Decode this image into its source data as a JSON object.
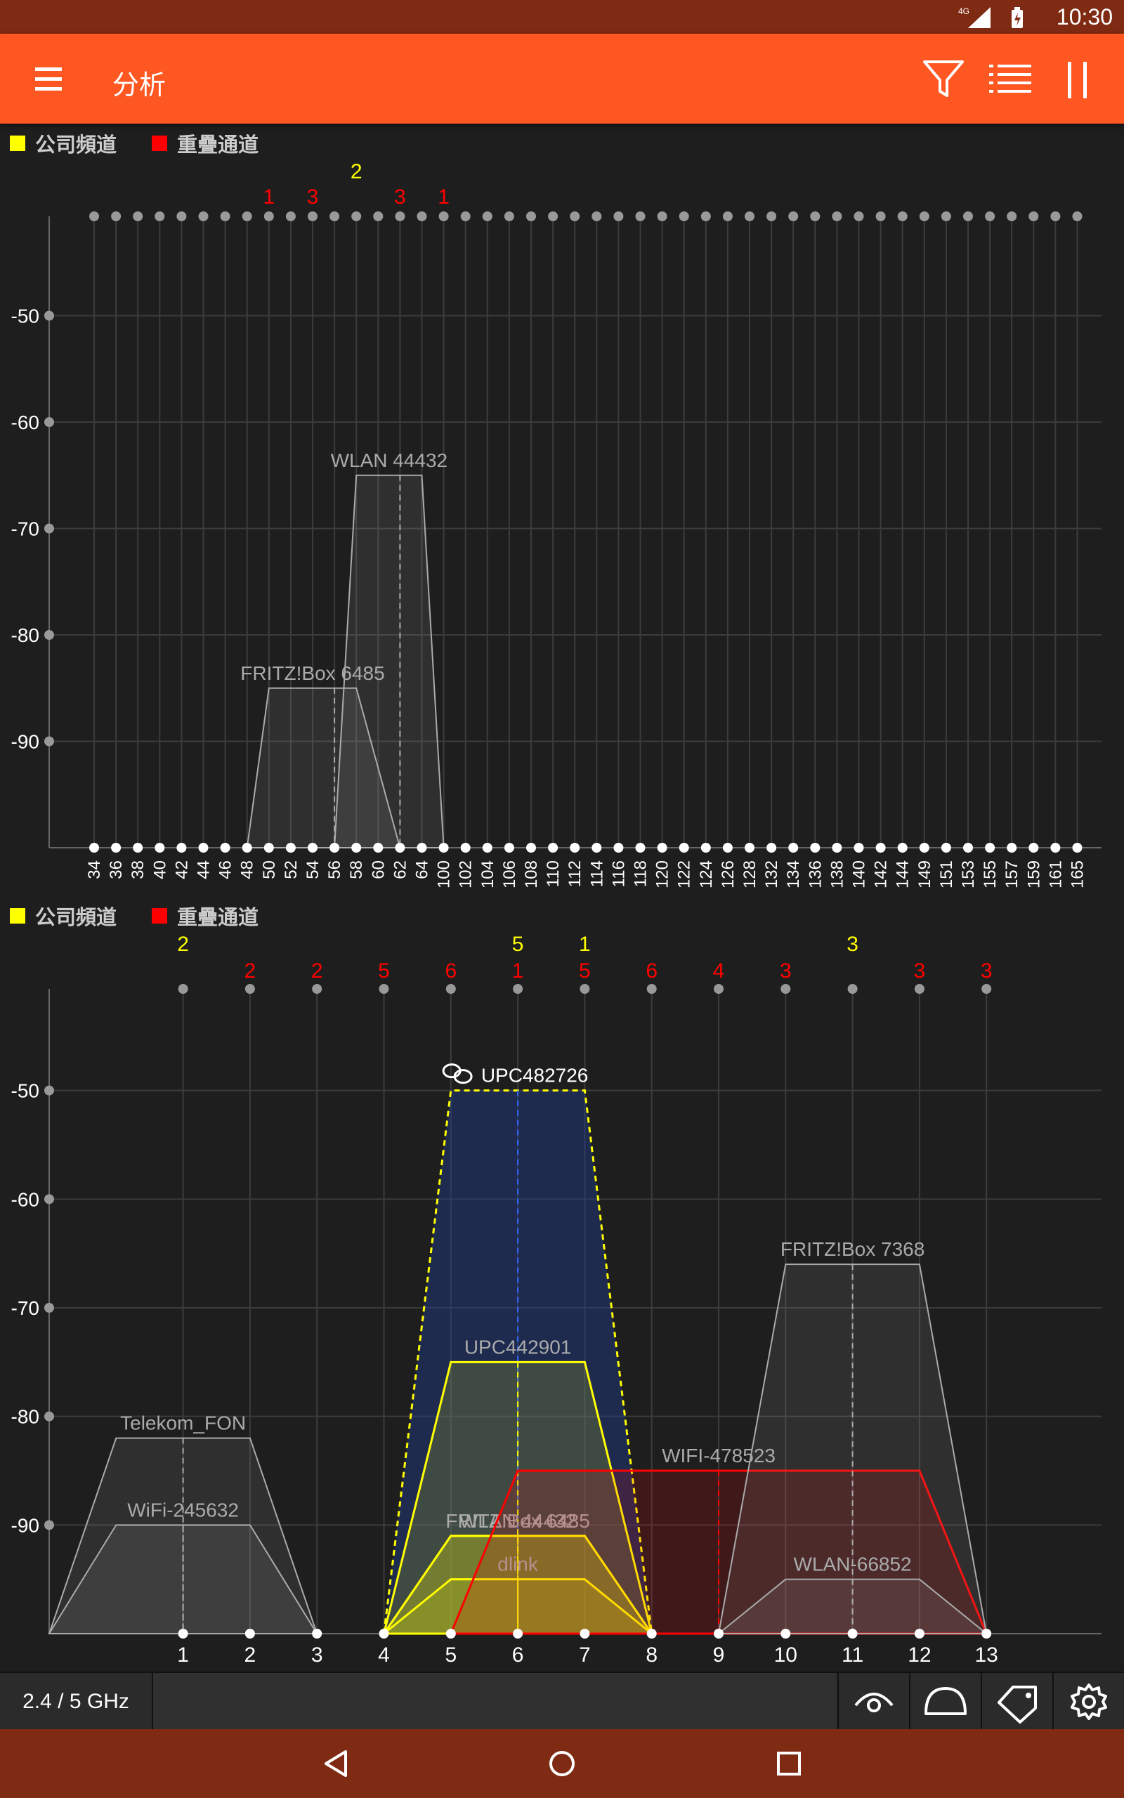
{
  "status": {
    "time": "10:30",
    "network": "4G"
  },
  "appbar": {
    "title": "分析"
  },
  "legend": {
    "company_label": "公司頻道",
    "overlap_label": "重疊通道",
    "company_color": "#ffff00",
    "overlap_color": "#ff0000"
  },
  "chart_data": [
    {
      "type": "area",
      "band": "5 GHz",
      "yticks": [
        "-50",
        "-60",
        "-70",
        "-80",
        "-90"
      ],
      "ylim": [
        -100,
        -40
      ],
      "x": [
        "34",
        "36",
        "38",
        "40",
        "42",
        "44",
        "46",
        "48",
        "50",
        "52",
        "54",
        "56",
        "58",
        "60",
        "62",
        "64",
        "100",
        "102",
        "104",
        "106",
        "108",
        "110",
        "112",
        "114",
        "116",
        "118",
        "120",
        "122",
        "124",
        "126",
        "128",
        "132",
        "134",
        "136",
        "138",
        "140",
        "142",
        "144",
        "149",
        "151",
        "153",
        "155",
        "157",
        "159",
        "161",
        "165"
      ],
      "counts": [
        {
          "channel": "50",
          "count": "1",
          "color": "#ff0000"
        },
        {
          "channel": "54",
          "count": "3",
          "color": "#ff0000"
        },
        {
          "channel": "58",
          "count": "2",
          "color": "#ffff00"
        },
        {
          "channel": "62",
          "count": "3",
          "color": "#ff0000"
        },
        {
          "channel": "100",
          "count": "1",
          "color": "#ff0000"
        }
      ],
      "series": [
        {
          "name": "WLAN 44432",
          "from": "56",
          "to": "100",
          "peak_from": "58",
          "peak_to": "64",
          "center": "62",
          "signal": -65,
          "color": "#aaaaaa"
        },
        {
          "name": "FRITZ!Box 6485",
          "from": "48",
          "to": "62",
          "peak_from": "50",
          "peak_to": "58",
          "center": "56",
          "signal": -85,
          "color": "#aaaaaa"
        }
      ]
    },
    {
      "type": "area",
      "band": "2.4 GHz",
      "yticks": [
        "-50",
        "-60",
        "-70",
        "-80",
        "-90"
      ],
      "ylim": [
        -100,
        -40
      ],
      "x": [
        "1",
        "2",
        "3",
        "4",
        "5",
        "6",
        "7",
        "8",
        "9",
        "10",
        "11",
        "12",
        "13"
      ],
      "counts": [
        {
          "channel": "1",
          "count": "2",
          "color": "#ffff00"
        },
        {
          "channel": "2",
          "count": "2",
          "color": "#ff0000"
        },
        {
          "channel": "3",
          "count": "2",
          "color": "#ff0000"
        },
        {
          "channel": "4",
          "count": "5",
          "color": "#ff0000"
        },
        {
          "channel": "5",
          "count": "6",
          "color": "#ff0000"
        },
        {
          "channel": "6",
          "count": "1",
          "color": "#ff0000"
        },
        {
          "channel": "6",
          "count": "5",
          "color": "#ffff00"
        },
        {
          "channel": "7",
          "count": "5",
          "color": "#ff0000"
        },
        {
          "channel": "7",
          "count": "1",
          "color": "#ffff00"
        },
        {
          "channel": "8",
          "count": "6",
          "color": "#ff0000"
        },
        {
          "channel": "9",
          "count": "4",
          "color": "#ff0000"
        },
        {
          "channel": "10",
          "count": "3",
          "color": "#ff0000"
        },
        {
          "channel": "11",
          "count": "3",
          "color": "#ffff00"
        },
        {
          "channel": "12",
          "count": "3",
          "color": "#ff0000"
        },
        {
          "channel": "13",
          "count": "3",
          "color": "#ff0000"
        }
      ],
      "series": [
        {
          "name": "UPC482726",
          "from": 4,
          "to": 8,
          "peak_from": 5,
          "peak_to": 7,
          "center": 6,
          "signal": -50,
          "color": "#ffff00",
          "dashed": true,
          "connected": true
        },
        {
          "name": "UPC442901",
          "from": 4,
          "to": 8,
          "peak_from": 5,
          "peak_to": 7,
          "center": 6,
          "signal": -75,
          "color": "#ffff00"
        },
        {
          "name": "FRITZ!Box 6485",
          "from": 4,
          "to": 8,
          "peak_from": 5,
          "peak_to": 7,
          "center": 6,
          "signal": -91,
          "color": "#ffff00"
        },
        {
          "name": "WLAN 44432",
          "from": 4,
          "to": 8,
          "peak_from": 5,
          "peak_to": 7,
          "center": 6,
          "signal": -91,
          "color": "#ffff00"
        },
        {
          "name": "dlink",
          "from": 4,
          "to": 8,
          "peak_from": 5,
          "peak_to": 7,
          "center": 6,
          "signal": -95,
          "color": "#ffff00"
        },
        {
          "name": "WIFI-478523",
          "from": 5,
          "to": 13,
          "peak_from": 6,
          "peak_to": 12,
          "center": 9,
          "signal": -85,
          "color": "#ff0000"
        },
        {
          "name": "FRITZ!Box 7368",
          "from": 9,
          "to": 13,
          "peak_from": 10,
          "peak_to": 12,
          "center": 11,
          "signal": -66,
          "color": "#aaaaaa"
        },
        {
          "name": "WLAN-66852",
          "from": 9,
          "to": 13,
          "peak_from": 10,
          "peak_to": 12,
          "center": 11,
          "signal": -95,
          "color": "#aaaaaa"
        },
        {
          "name": "Telekom_FON",
          "from": -1,
          "to": 3,
          "peak_from": 0,
          "peak_to": 2,
          "center": 1,
          "signal": -82,
          "color": "#aaaaaa"
        },
        {
          "name": "WiFi-245632",
          "from": -1,
          "to": 3,
          "peak_from": 0,
          "peak_to": 2,
          "center": 1,
          "signal": -90,
          "color": "#aaaaaa"
        }
      ]
    }
  ],
  "bottombar": {
    "band_label": "2.4 / 5 GHz"
  },
  "icons": {
    "menu": "hamburger-icon",
    "filter": "filter-icon",
    "list": "list-icon",
    "pause": "pause-icon",
    "eye": "eye-icon",
    "signal": "half-circle-icon",
    "tag": "tag-icon",
    "settings": "gear-icon",
    "back": "back-triangle-icon",
    "home": "home-circle-icon",
    "recents": "recents-square-icon"
  }
}
